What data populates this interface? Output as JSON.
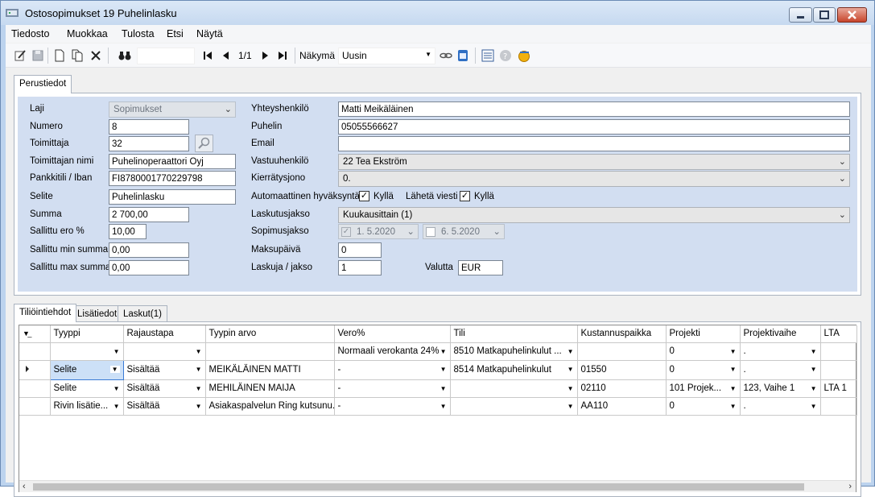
{
  "window": {
    "title": "Ostosopimukset 19 Puhelinlasku"
  },
  "menu": [
    "Tiedosto",
    "Muokkaa",
    "Tulosta",
    "Etsi",
    "Näytä"
  ],
  "toolbar": {
    "pager": "1/1",
    "view_label": "Näkymä",
    "view_value": "Uusin"
  },
  "top_tab": "Perustiedot",
  "form": {
    "laji": {
      "label": "Laji",
      "value": "Sopimukset"
    },
    "numero": {
      "label": "Numero",
      "value": "8"
    },
    "toimittaja": {
      "label": "Toimittaja",
      "value": "32"
    },
    "toimittajan_nimi": {
      "label": "Toimittajan nimi",
      "value": "Puhelinoperaattori Oyj"
    },
    "pankkitili": {
      "label": "Pankkitili / Iban",
      "value": "FI8780001770229798"
    },
    "selite": {
      "label": "Selite",
      "value": "Puhelinlasku"
    },
    "summa": {
      "label": "Summa",
      "value": "2 700,00"
    },
    "sallittu_ero": {
      "label": "Sallittu ero %",
      "value": "10,00"
    },
    "sallittu_min": {
      "label": "Sallittu min summa",
      "value": "0,00"
    },
    "sallittu_max": {
      "label": "Sallittu max summa",
      "value": "0,00"
    },
    "yhteyshenkilo": {
      "label": "Yhteyshenkilö",
      "value": "Matti Meikäläinen"
    },
    "puhelin": {
      "label": "Puhelin",
      "value": "05055566627"
    },
    "email": {
      "label": "Email",
      "value": ""
    },
    "vastuuhenkilo": {
      "label": "Vastuuhenkilö",
      "value": "22 Tea Ekström"
    },
    "kierratysjono": {
      "label": "Kierrätysjono",
      "value": "0."
    },
    "auto_hyvaksynta": {
      "label": "Automaattinen hyväksyntä",
      "check_label": "Kyllä"
    },
    "laheta_viesti": {
      "label": "Lähetä viesti",
      "check_label": "Kyllä"
    },
    "laskutusjakso": {
      "label": "Laskutusjakso",
      "value": "Kuukausittain (1)"
    },
    "sopimusjakso": {
      "label": "Sopimusjakso",
      "start": "1.  5.2020",
      "end": "6.  5.2020"
    },
    "maksupaiva": {
      "label": "Maksupäivä",
      "value": "0"
    },
    "laskuja_jakso": {
      "label": "Laskuja / jakso",
      "value": "1"
    },
    "valutta": {
      "label": "Valutta",
      "value": "EUR"
    }
  },
  "grid_tabs": [
    "Tiliöintiehdot",
    "Lisätiedot",
    "Laskut(1)"
  ],
  "grid": {
    "columns": [
      "Tyyppi",
      "Rajaustapa",
      "Tyypin arvo",
      "Vero%",
      "Tili",
      "Kustannuspaikka",
      "Projekti",
      "Projektivaihe",
      "LTA"
    ],
    "rows": [
      [
        "",
        "",
        "",
        "Normaali verokanta 24%",
        "8510 Matkapuhelinkulut ...",
        "",
        "0",
        ".",
        ""
      ],
      [
        "Selite",
        "Sisältää",
        "MEIKÄLÄINEN MATTI",
        "-",
        "8514 Matkapuhelinkulut",
        "01550",
        "0",
        ".",
        ""
      ],
      [
        "Selite",
        "Sisältää",
        "MEHILÄINEN MAIJA",
        "-",
        "",
        "02110",
        "101 Projek...",
        "123, Vaihe 1",
        "LTA 1"
      ],
      [
        "Rivin lisätie...",
        "Sisältää",
        "Asiakaspalvelun Ring kutsunu...",
        "-",
        "",
        "AA110",
        "0",
        ".",
        ""
      ]
    ]
  },
  "colors": {
    "form_bg": "#d2def1",
    "selection": "#cce0f7"
  }
}
